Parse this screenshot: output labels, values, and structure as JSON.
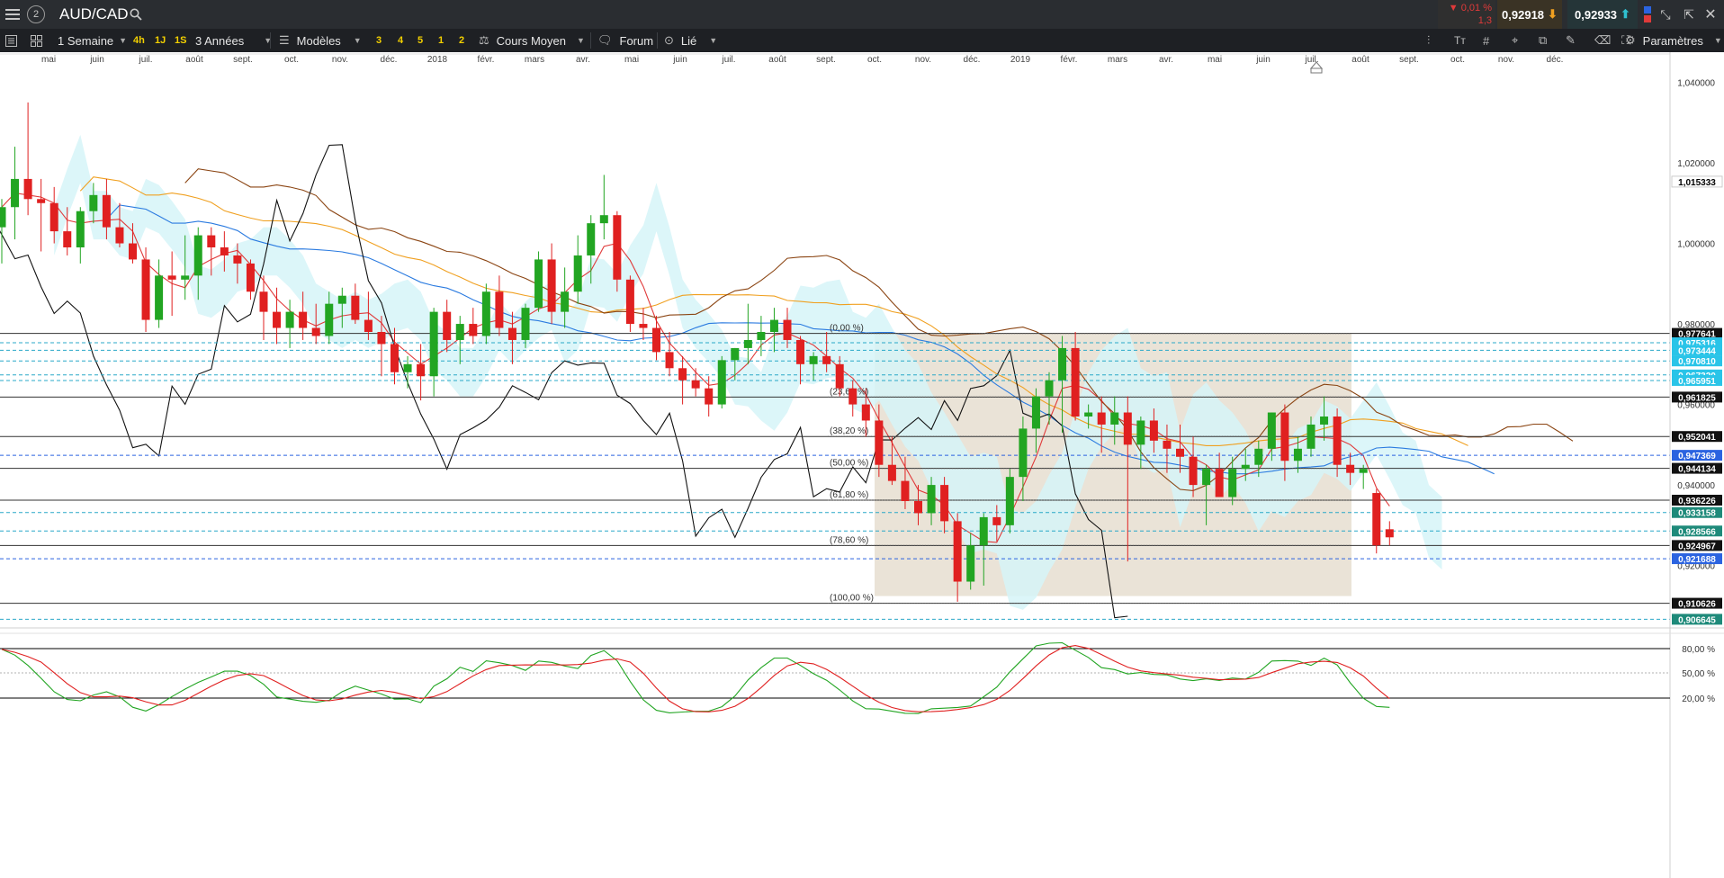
{
  "topbar": {
    "menu_icon": "hamburger-icon",
    "window_number": "2",
    "symbol": "AUD/CAD",
    "change_pct": "▼ 0,01 %",
    "change_abs": "1,3",
    "bid": "0,92918",
    "ask": "0,92933"
  },
  "toolbar": {
    "period": "1 Semaine",
    "quick_periods": [
      "4h",
      "1J",
      "1S"
    ],
    "range": "3 Années",
    "templates": "Modèles",
    "quick_nums": [
      "3",
      "4",
      "5",
      "1",
      "2"
    ],
    "price_type": "Cours Moyen",
    "forum": "Forum",
    "linked": "Lié",
    "settings": "Paramètres"
  },
  "chart_data": {
    "type": "candlestick",
    "period": "weekly",
    "time_labels": [
      "mai",
      "juin",
      "juil.",
      "août",
      "sept.",
      "oct.",
      "nov.",
      "déc.",
      "2018",
      "févr.",
      "mars",
      "avr.",
      "mai",
      "juin",
      "juil.",
      "août",
      "sept.",
      "oct.",
      "nov.",
      "déc.",
      "2019",
      "févr.",
      "mars",
      "avr.",
      "mai",
      "juin",
      "juil.",
      "août",
      "sept.",
      "oct.",
      "nov.",
      "déc."
    ],
    "y_axis": {
      "labels": [
        "1,040000",
        "1,020000",
        "1,000000",
        "0,980000",
        "0,960000",
        "0,940000",
        "0,920000"
      ],
      "min": 0.9045,
      "max": 1.0448
    },
    "price_tags": [
      {
        "value": "1,015333",
        "color": "#ffffff",
        "text": "#000000"
      },
      {
        "value": "0,977641",
        "color": "#111111",
        "text": "#ffffff"
      },
      {
        "value": "0,975316",
        "color": "#29c4e8",
        "text": "#ffffff"
      },
      {
        "value": "0,973444",
        "color": "#29c4e8",
        "text": "#ffffff"
      },
      {
        "value": "0,970810",
        "color": "#29c4e8",
        "text": "#ffffff"
      },
      {
        "value": "0,967320",
        "color": "#29c4e8",
        "text": "#ffffff"
      },
      {
        "value": "0,965951",
        "color": "#29c4e8",
        "text": "#ffffff"
      },
      {
        "value": "0,961825",
        "color": "#111111",
        "text": "#ffffff"
      },
      {
        "value": "0,952041",
        "color": "#111111",
        "text": "#ffffff"
      },
      {
        "value": "0,947369",
        "color": "#2b63e0",
        "text": "#ffffff"
      },
      {
        "value": "0,944134",
        "color": "#111111",
        "text": "#ffffff"
      },
      {
        "value": "0,936226",
        "color": "#111111",
        "text": "#ffffff"
      },
      {
        "value": "0,933158",
        "color": "#1e8a7a",
        "text": "#ffffff"
      },
      {
        "value": "0,928566",
        "color": "#1e8a7a",
        "text": "#ffffff"
      },
      {
        "value": "0,924967",
        "color": "#111111",
        "text": "#ffffff"
      },
      {
        "value": "0,921688",
        "color": "#2b63e0",
        "text": "#ffffff"
      },
      {
        "value": "0,910626",
        "color": "#111111",
        "text": "#ffffff"
      },
      {
        "value": "0,906645",
        "color": "#1e8a7a",
        "text": "#ffffff"
      }
    ],
    "fibonacci": {
      "levels": [
        "(0,00 %)",
        "(23,60 %)",
        "(38,20 %)",
        "(50,00 %)",
        "(61,80 %)",
        "(78,60 %)",
        "(100,00 %)"
      ],
      "values": [
        0.97764,
        0.96182,
        0.95204,
        0.94413,
        0.93623,
        0.92497,
        0.91063
      ]
    },
    "series": [
      {
        "name": "candles",
        "values": [
          [
            1.004,
            1.011,
            0.995,
            1.009
          ],
          [
            1.009,
            1.024,
            1.001,
            1.016
          ],
          [
            1.016,
            1.035,
            1.007,
            1.011
          ],
          [
            1.011,
            1.016,
            0.998,
            1.01
          ],
          [
            1.01,
            1.014,
            1.0,
            1.003
          ],
          [
            1.003,
            1.009,
            0.997,
            0.999
          ],
          [
            0.999,
            1.009,
            0.995,
            1.008
          ],
          [
            1.008,
            1.015,
            1.005,
            1.012
          ],
          [
            1.012,
            1.016,
            1.001,
            1.004
          ],
          [
            1.004,
            1.01,
            0.999,
            1.0
          ],
          [
            1.0,
            1.005,
            0.995,
            0.996
          ],
          [
            0.996,
            0.999,
            0.978,
            0.981
          ],
          [
            0.981,
            0.996,
            0.979,
            0.992
          ],
          [
            0.992,
            0.998,
            0.982,
            0.991
          ],
          [
            0.991,
            1.002,
            0.986,
            0.992
          ],
          [
            0.992,
            1.004,
            0.986,
            1.002
          ],
          [
            1.002,
            1.004,
            0.992,
            0.999
          ],
          [
            0.999,
            1.003,
            0.993,
            0.997
          ],
          [
            0.997,
            1.0,
            0.99,
            0.995
          ],
          [
            0.995,
            0.996,
            0.986,
            0.988
          ],
          [
            0.988,
            0.992,
            0.976,
            0.983
          ],
          [
            0.983,
            0.989,
            0.975,
            0.979
          ],
          [
            0.979,
            0.986,
            0.974,
            0.983
          ],
          [
            0.983,
            0.988,
            0.976,
            0.979
          ],
          [
            0.979,
            0.985,
            0.975,
            0.977
          ],
          [
            0.977,
            0.988,
            0.975,
            0.985
          ],
          [
            0.985,
            0.989,
            0.979,
            0.987
          ],
          [
            0.987,
            0.99,
            0.98,
            0.981
          ],
          [
            0.981,
            0.988,
            0.976,
            0.978
          ],
          [
            0.978,
            0.982,
            0.967,
            0.975
          ],
          [
            0.975,
            0.979,
            0.965,
            0.968
          ],
          [
            0.968,
            0.972,
            0.964,
            0.97
          ],
          [
            0.97,
            0.975,
            0.961,
            0.967
          ],
          [
            0.967,
            0.984,
            0.962,
            0.983
          ],
          [
            0.983,
            0.986,
            0.973,
            0.976
          ],
          [
            0.976,
            0.982,
            0.97,
            0.98
          ],
          [
            0.98,
            0.984,
            0.975,
            0.977
          ],
          [
            0.977,
            0.99,
            0.975,
            0.988
          ],
          [
            0.988,
            0.992,
            0.977,
            0.979
          ],
          [
            0.979,
            0.983,
            0.97,
            0.976
          ],
          [
            0.976,
            0.985,
            0.974,
            0.984
          ],
          [
            0.984,
            0.998,
            0.983,
            0.996
          ],
          [
            0.996,
            1.0,
            0.98,
            0.983
          ],
          [
            0.983,
            0.994,
            0.979,
            0.988
          ],
          [
            0.988,
            1.002,
            0.985,
            0.997
          ],
          [
            0.997,
            1.007,
            0.99,
            1.005
          ],
          [
            1.005,
            1.017,
            1.001,
            1.007
          ],
          [
            1.007,
            1.008,
            0.988,
            0.991
          ],
          [
            0.991,
            0.992,
            0.978,
            0.98
          ],
          [
            0.98,
            0.984,
            0.976,
            0.979
          ],
          [
            0.979,
            0.982,
            0.971,
            0.973
          ],
          [
            0.973,
            0.978,
            0.967,
            0.969
          ],
          [
            0.969,
            0.972,
            0.96,
            0.966
          ],
          [
            0.966,
            0.969,
            0.962,
            0.964
          ],
          [
            0.964,
            0.967,
            0.957,
            0.96
          ],
          [
            0.96,
            0.972,
            0.959,
            0.971
          ],
          [
            0.971,
            0.974,
            0.966,
            0.974
          ],
          [
            0.974,
            0.985,
            0.97,
            0.976
          ],
          [
            0.976,
            0.982,
            0.972,
            0.978
          ],
          [
            0.978,
            0.984,
            0.973,
            0.981
          ],
          [
            0.981,
            0.984,
            0.974,
            0.976
          ],
          [
            0.976,
            0.977,
            0.965,
            0.97
          ],
          [
            0.97,
            0.973,
            0.966,
            0.972
          ],
          [
            0.972,
            0.978,
            0.968,
            0.97
          ],
          [
            0.97,
            0.972,
            0.962,
            0.964
          ],
          [
            0.964,
            0.966,
            0.957,
            0.96
          ],
          [
            0.96,
            0.964,
            0.952,
            0.956
          ],
          [
            0.956,
            0.96,
            0.942,
            0.945
          ],
          [
            0.945,
            0.952,
            0.94,
            0.941
          ],
          [
            0.941,
            0.947,
            0.934,
            0.936
          ],
          [
            0.936,
            0.94,
            0.93,
            0.933
          ],
          [
            0.933,
            0.942,
            0.93,
            0.94
          ],
          [
            0.94,
            0.942,
            0.928,
            0.931
          ],
          [
            0.931,
            0.933,
            0.911,
            0.916
          ],
          [
            0.916,
            0.928,
            0.914,
            0.925
          ],
          [
            0.925,
            0.933,
            0.915,
            0.932
          ],
          [
            0.932,
            0.935,
            0.926,
            0.93
          ],
          [
            0.93,
            0.944,
            0.928,
            0.942
          ],
          [
            0.942,
            0.957,
            0.936,
            0.954
          ],
          [
            0.954,
            0.964,
            0.948,
            0.962
          ],
          [
            0.962,
            0.968,
            0.955,
            0.966
          ],
          [
            0.966,
            0.977,
            0.953,
            0.974
          ],
          [
            0.974,
            0.978,
            0.956,
            0.957
          ],
          [
            0.957,
            0.96,
            0.954,
            0.958
          ],
          [
            0.958,
            0.962,
            0.948,
            0.955
          ],
          [
            0.955,
            0.962,
            0.95,
            0.958
          ],
          [
            0.958,
            0.962,
            0.921,
            0.95
          ],
          [
            0.95,
            0.957,
            0.944,
            0.956
          ],
          [
            0.956,
            0.959,
            0.948,
            0.951
          ],
          [
            0.951,
            0.955,
            0.943,
            0.949
          ],
          [
            0.949,
            0.955,
            0.943,
            0.947
          ],
          [
            0.947,
            0.952,
            0.937,
            0.94
          ],
          [
            0.94,
            0.945,
            0.93,
            0.944
          ],
          [
            0.944,
            0.948,
            0.937,
            0.937
          ],
          [
            0.937,
            0.947,
            0.935,
            0.944
          ],
          [
            0.944,
            0.949,
            0.941,
            0.945
          ],
          [
            0.945,
            0.951,
            0.942,
            0.949
          ],
          [
            0.949,
            0.958,
            0.946,
            0.958
          ],
          [
            0.958,
            0.96,
            0.941,
            0.946
          ],
          [
            0.946,
            0.952,
            0.943,
            0.949
          ],
          [
            0.949,
            0.957,
            0.947,
            0.955
          ],
          [
            0.955,
            0.962,
            0.951,
            0.957
          ],
          [
            0.957,
            0.959,
            0.942,
            0.945
          ],
          [
            0.945,
            0.948,
            0.94,
            0.943
          ],
          [
            0.943,
            0.945,
            0.939,
            0.944
          ],
          [
            0.938,
            0.939,
            0.923,
            0.925
          ],
          [
            0.929,
            0.931,
            0.925,
            0.927
          ]
        ]
      },
      {
        "name": "stochastic",
        "levels": [
          "80,00 %",
          "50,00 %",
          "20,00 %"
        ]
      }
    ]
  }
}
